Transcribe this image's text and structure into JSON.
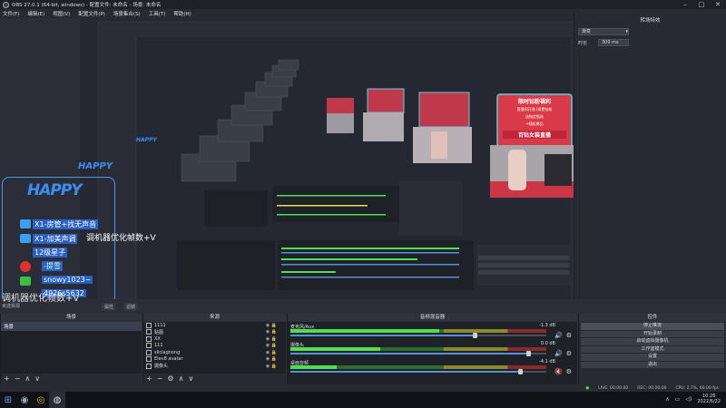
{
  "window": {
    "title": "OBS 27.0.1 (64-bit, windows) - 配置文件: 未命名 - 场景: 未命名"
  },
  "menu": [
    "文件(F)",
    "编辑(E)",
    "视图(V)",
    "配置文件(P)",
    "场景集合(S)",
    "工具(T)",
    "帮助(H)"
  ],
  "preview": {
    "overlay_happy": "HAPPY",
    "overlay_lines": [
      "X1-房管+找无声音",
      "X1-加美声调",
      "12级星子",
      "-提雪",
      "snowy1023~",
      "4926s5632"
    ],
    "promo_title": "限时钻粉福利",
    "promo_lines": [
      "直播间开通 (续费钻粉",
      "送指定甄选",
      "+随机赠品"
    ],
    "promo_banner": "百钻女装直播",
    "promo_extra": "6"
  },
  "scene_label": "调机器优化帧数+V",
  "scene_sub": "未选择源",
  "preview_bar": [
    "属性",
    "滤镜"
  ],
  "transition": {
    "title": "转场特效",
    "type": "渐变",
    "duration_label": "时长",
    "duration_value": "300 ms"
  },
  "scenes_panel": {
    "title": "场景",
    "items": [
      "场景"
    ]
  },
  "sources_panel": {
    "title": "来源",
    "items": [
      "1111",
      "贴图",
      "XX",
      "111",
      "sliciagnong",
      "Elev8 avatar",
      "摄像头"
    ]
  },
  "mixer": {
    "title": "音频混音器",
    "channels": [
      {
        "name": "麦克风/Aux",
        "db": "-1.3 dB",
        "level": 0.58,
        "volume": 0.72,
        "muted": false
      },
      {
        "name": "摄像头",
        "db": "0.0 dB",
        "level": 0.35,
        "volume": 0.93,
        "muted": false
      },
      {
        "name": "桌面音频",
        "db": "-4.1 dB",
        "level": 0.18,
        "volume": 0.9,
        "muted": true
      }
    ]
  },
  "controls": {
    "title": "控件",
    "buttons": [
      "停止推流",
      "开始录制",
      "启动虚拟摄像机",
      "工作室模式",
      "设置",
      "退出"
    ]
  },
  "statusbar": {
    "live": "LIVE: 00:00:00",
    "rec": "REC: 00:00:00",
    "cpu": "CPU: 2.7%, 60.00 fps"
  },
  "taskbar": {
    "time": "10:26",
    "date": "2022/6/22"
  }
}
